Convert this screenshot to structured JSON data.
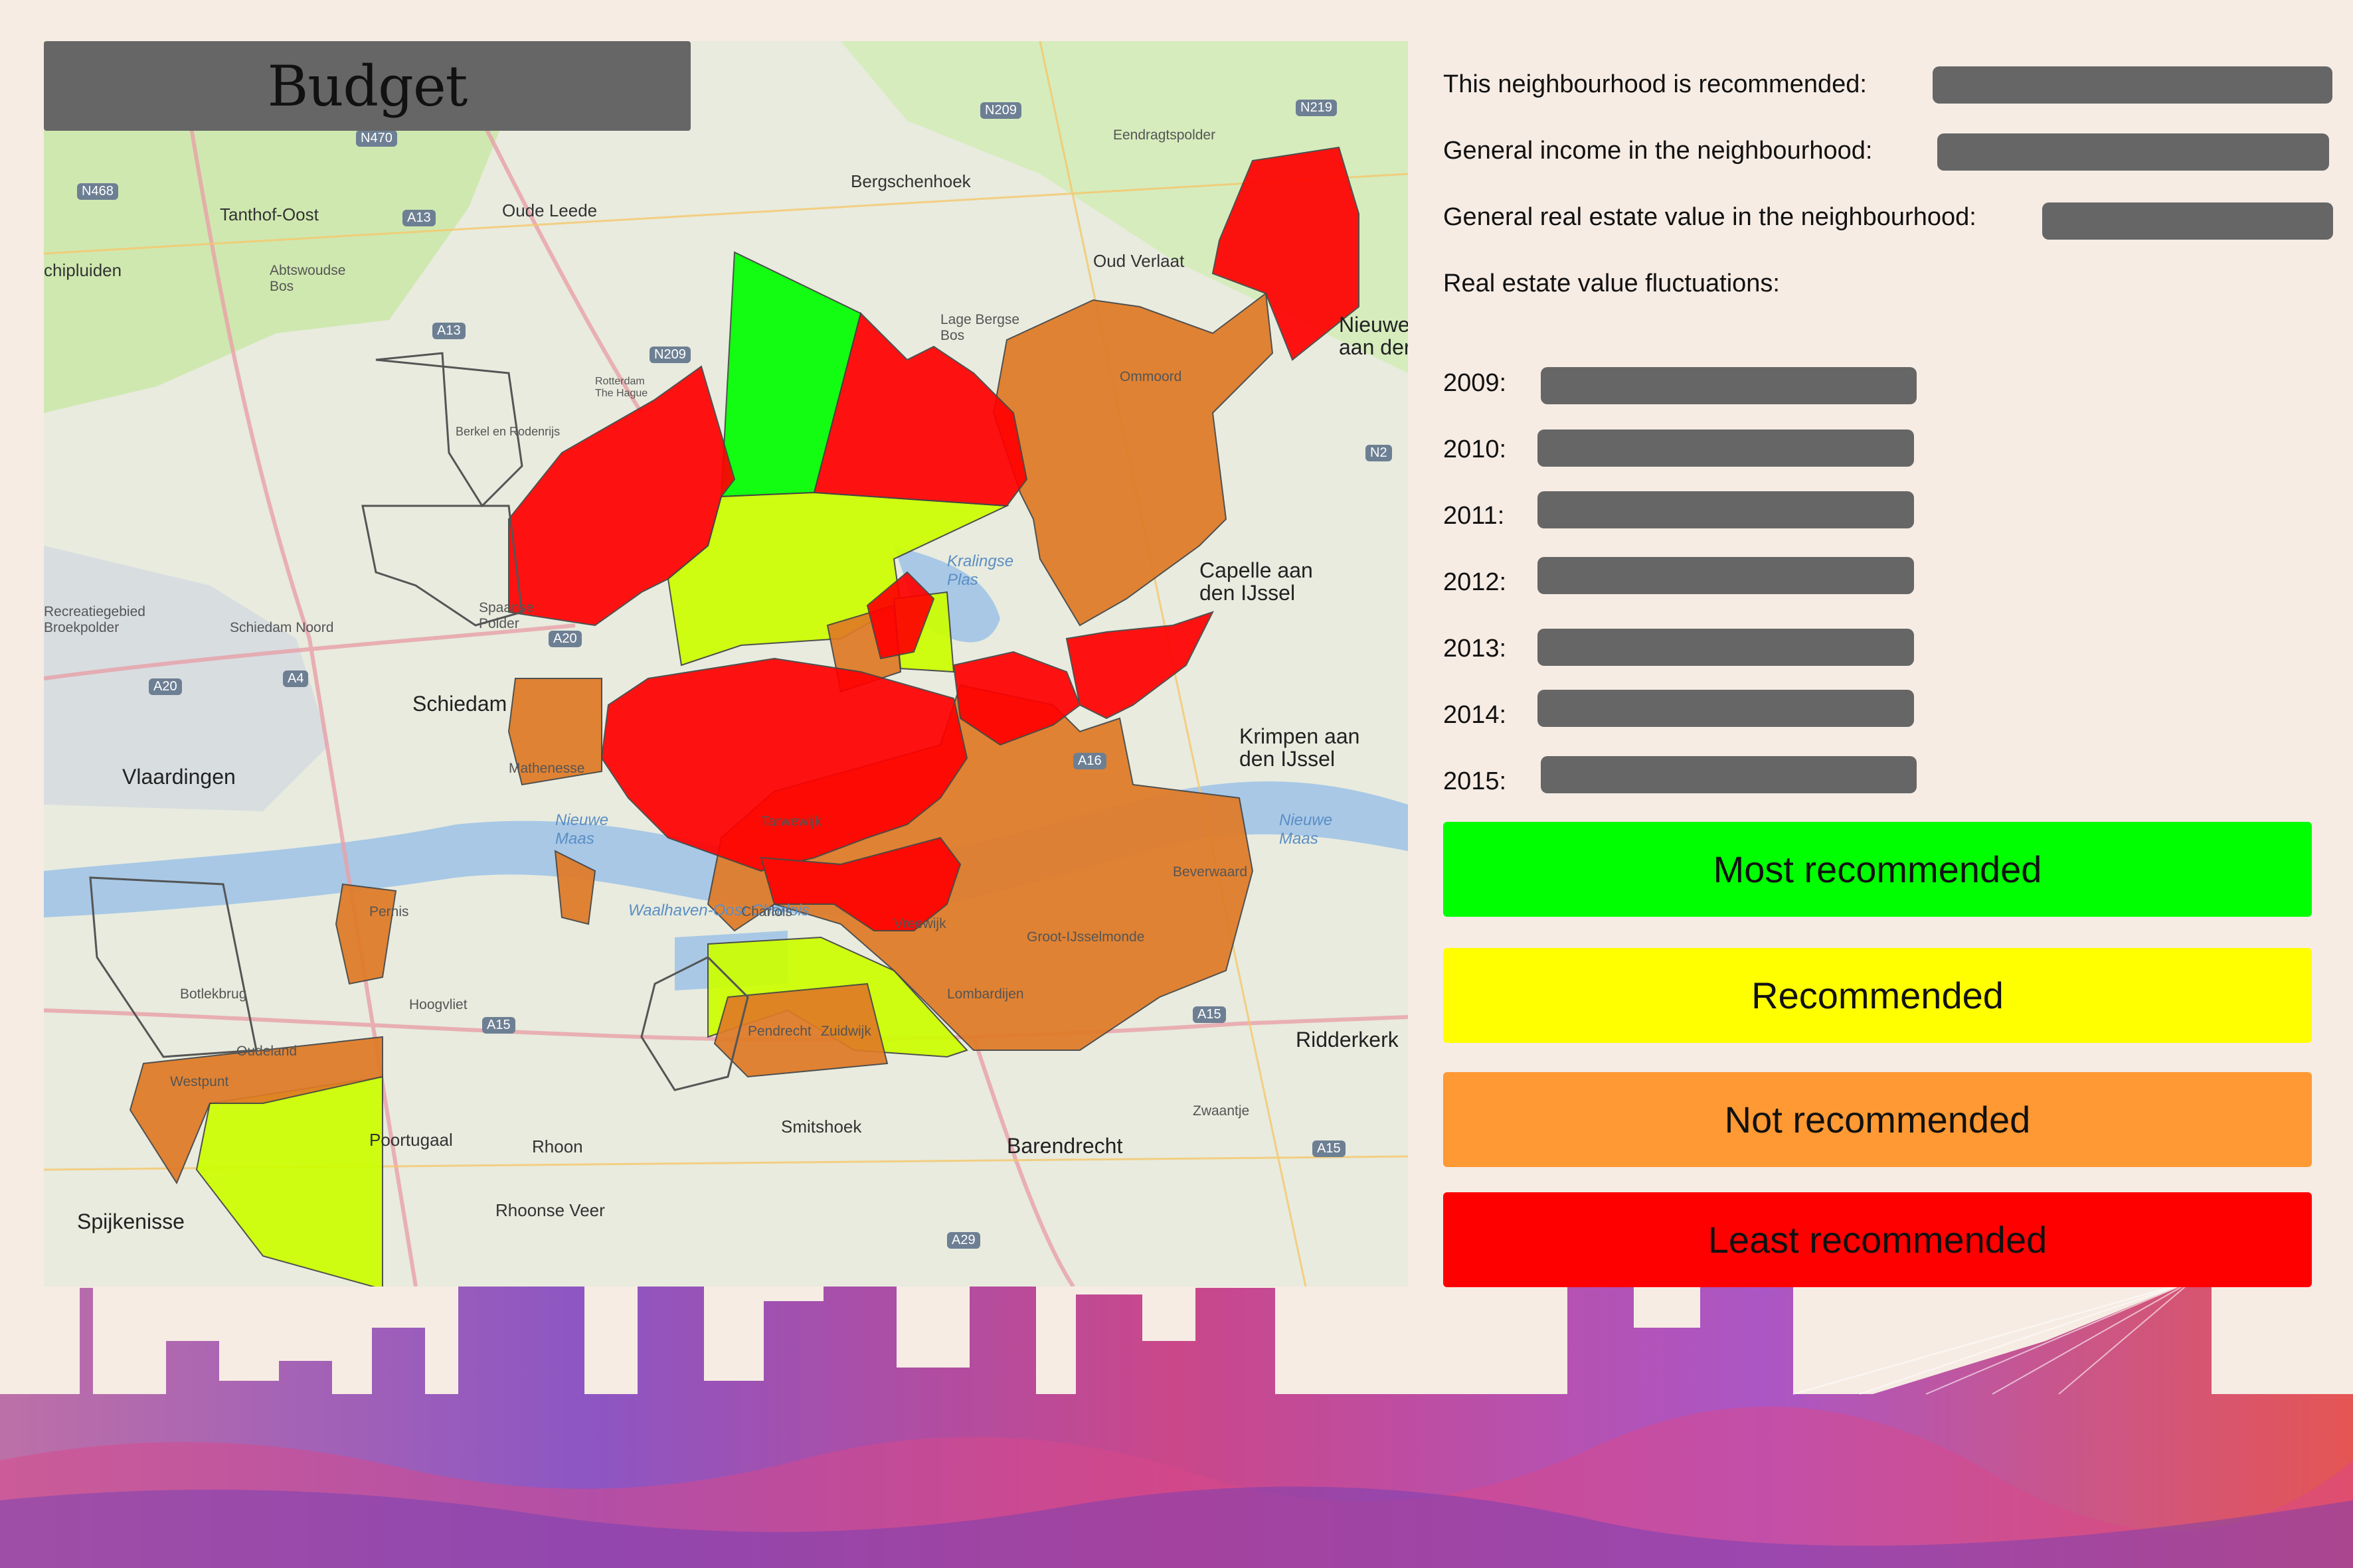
{
  "map": {
    "title": "Budget",
    "places": {
      "oudeleede": "Oude Leede",
      "bergschenhoek": "Bergschenhoek",
      "tanthof": "Tanthof-Oost",
      "abtswoudse": "Abtswoudse Bos",
      "schipluiden": "chipluiden",
      "oudverlaat": "Oud Verlaat",
      "eendragtspolder": "Eendragtspolder",
      "lagebergse": "Lage Bergse Bos",
      "ommoord": "Ommoord",
      "nieuwerkerk": "Nieuwe aan der",
      "kralingse": "Kralingse Plas",
      "capelle": "Capelle aan den IJssel",
      "schiedam": "Schiedam",
      "spaanse": "Spaanse Polder",
      "vlaardingen": "Vlaardingen",
      "krimpen": "Krimpen aan den IJssel",
      "mathenesse": "Mathenesse",
      "nieuwemaas": "Nieuwe Maas",
      "nieuwemaas2": "Nieuwe Maas",
      "waalhaven": "Waalhaven-Oost Charlois",
      "pernis": "Pernis",
      "feijenoord": "Feijenoord",
      "vreewijk": "Vreewijk",
      "grootijssel": "Groot-IJsselmonde",
      "lombardijen": "Lombardijen",
      "beverwaard": "Beverwaard",
      "oudeland": "Oudeland",
      "westpunt": "Westpunt",
      "hoogvliet": "Hoogvliet",
      "botlek": "Botlekbrug",
      "poortugaal": "Poortugaal",
      "rhoon": "Rhoon",
      "smitshoek": "Smitshoek",
      "barendrecht": "Barendrecht",
      "zwaantje": "Zwaantje",
      "ridderkerk": "Ridderkerk",
      "rhoonseveer": "Rhoonse Veer",
      "spijkenisse": "Spijkenisse",
      "pendrecht": "Pendrecht",
      "zuidwijk": "Zuidwijk",
      "recreatie": "Recreatiegebied Broekpolder",
      "schiedamnoord": "Schiedam Noord",
      "zestienhoven": "Rotterdam The Hague",
      "berkelrodenrijs": "Berkel en Rodenrijs",
      "tarwewijk": "Tarwewijk",
      "charlois": "Charlois"
    },
    "roads": {
      "a13": "A13",
      "a13b": "A13",
      "a20": "A20",
      "a20b": "A20",
      "a4": "A4",
      "a15": "A15",
      "a15b": "A15",
      "a15c": "A15",
      "a16": "A16",
      "a29": "A29",
      "n470": "N470",
      "n468": "N468",
      "n209": "N209",
      "n219": "N219",
      "n209b": "N209",
      "n20": "N2"
    },
    "colors": {
      "most": "#00ff00",
      "recommended": "#ccff00",
      "not": "#e07a25",
      "least": "#ff0000"
    }
  },
  "info": {
    "recommended_label": "This neighbourhood is recommended:",
    "income_label": "General income in the neighbourhood:",
    "realestate_label": "General real estate value in the neighbourhood:",
    "fluctuations_label": "Real estate value fluctuations:",
    "years": [
      "2009:",
      "2010:",
      "2011:",
      "2012:",
      "2013:",
      "2014:",
      "2015:"
    ]
  },
  "legend": [
    {
      "label": "Most recommended",
      "color": "#00ff00"
    },
    {
      "label": "Recommended",
      "color": "#ffff00"
    },
    {
      "label": "Not recommended",
      "color": "#ff9933"
    },
    {
      "label": "Least recommended",
      "color": "#ff0000"
    }
  ]
}
